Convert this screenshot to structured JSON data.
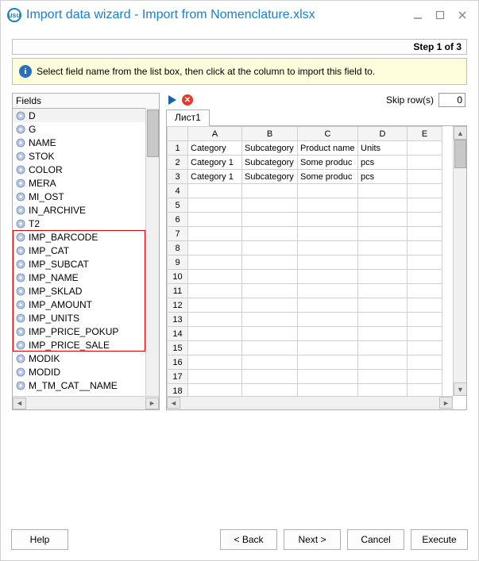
{
  "title": "Import data wizard - Import from Nomenclature.xlsx",
  "step_label": "Step 1 of 3",
  "info_text": "Select field name from the list box, then click at the column to import this field to.",
  "fields_header": "Fields",
  "fields": [
    "D",
    "G",
    "NAME",
    "STOK",
    "COLOR",
    "MERA",
    "MI_OST",
    "IN_ARCHIVE",
    "T2",
    "IMP_BARCODE",
    "IMP_CAT",
    "IMP_SUBCAT",
    "IMP_NAME",
    "IMP_SKLAD",
    "IMP_AMOUNT",
    "IMP_UNITS",
    "IMP_PRICE_POKUP",
    "IMP_PRICE_SALE",
    "MODIK",
    "MODID",
    "M_TM_CAT__NAME"
  ],
  "highlight_start": 9,
  "highlight_end": 17,
  "skip_label": "Skip row(s)",
  "skip_value": "0",
  "sheet_tab": "Лист1",
  "grid": {
    "columns": [
      "A",
      "B",
      "C",
      "D",
      "E"
    ],
    "rows": [
      [
        "Category",
        "Subcategory",
        "Product name",
        "Units",
        ""
      ],
      [
        "Category 1",
        "Subcategory",
        "Some produc",
        "pcs",
        ""
      ],
      [
        "Category 1",
        "Subcategory",
        "Some produc",
        "pcs",
        ""
      ],
      [
        "",
        "",
        "",
        "",
        ""
      ],
      [
        "",
        "",
        "",
        "",
        ""
      ],
      [
        "",
        "",
        "",
        "",
        ""
      ],
      [
        "",
        "",
        "",
        "",
        ""
      ],
      [
        "",
        "",
        "",
        "",
        ""
      ],
      [
        "",
        "",
        "",
        "",
        ""
      ],
      [
        "",
        "",
        "",
        "",
        ""
      ],
      [
        "",
        "",
        "",
        "",
        ""
      ],
      [
        "",
        "",
        "",
        "",
        ""
      ],
      [
        "",
        "",
        "",
        "",
        ""
      ],
      [
        "",
        "",
        "",
        "",
        ""
      ],
      [
        "",
        "",
        "",
        "",
        ""
      ],
      [
        "",
        "",
        "",
        "",
        ""
      ],
      [
        "",
        "",
        "",
        "",
        ""
      ],
      [
        "",
        "",
        "",
        "",
        ""
      ],
      [
        "",
        "",
        "",
        "",
        ""
      ]
    ]
  },
  "buttons": {
    "help": "Help",
    "back": "< Back",
    "next": "Next >",
    "cancel": "Cancel",
    "execute": "Execute"
  }
}
